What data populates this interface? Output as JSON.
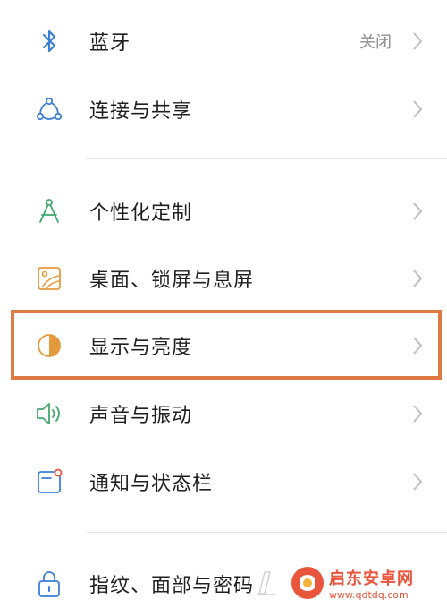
{
  "settings": {
    "items": [
      {
        "label": "蓝牙",
        "value": "关闭",
        "icon": "bluetooth-icon"
      },
      {
        "label": "连接与共享",
        "icon": "connection-share-icon"
      },
      {
        "label": "个性化定制",
        "icon": "personalization-icon"
      },
      {
        "label": "桌面、锁屏与息屏",
        "icon": "wallpaper-icon"
      },
      {
        "label": "显示与亮度",
        "icon": "display-brightness-icon"
      },
      {
        "label": "声音与振动",
        "icon": "sound-icon"
      },
      {
        "label": "通知与状态栏",
        "icon": "notification-icon"
      },
      {
        "label": "指纹、面部与密码",
        "icon": "lock-icon"
      }
    ]
  },
  "highlight": {
    "target": "显示与亮度",
    "color": "#e07a45"
  },
  "watermark": {
    "title": "启东安卓网",
    "url": "www.qdtdq.com"
  },
  "colors": {
    "blue": "#3d7fd6",
    "green": "#3fa86b",
    "orange": "#e39a3c",
    "chevron": "#bdbdbd"
  }
}
